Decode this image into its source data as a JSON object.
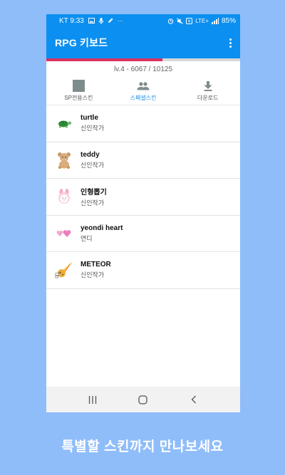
{
  "status_bar": {
    "carrier_time": "KT 9:33",
    "extra": "···",
    "network": "LTE+",
    "battery": "85%",
    "icons": [
      "image-icon",
      "mic-icon",
      "pen-icon",
      "alarm-icon",
      "mute-icon",
      "nfc-icon",
      "signal-icon"
    ]
  },
  "app_bar": {
    "title": "RPG 키보드"
  },
  "progress": {
    "level_text": "lv.4 - 6067 / 10125",
    "fraction": 0.599,
    "fill_color": "#d8325f"
  },
  "tabs": [
    {
      "label": "SP전용스킨",
      "icon": "square-icon",
      "active": false
    },
    {
      "label": "스페셜스킨",
      "icon": "people-icon",
      "active": true
    },
    {
      "label": "다운로드",
      "icon": "download-icon",
      "active": false
    }
  ],
  "skins": [
    {
      "name": "turtle",
      "author": "신인작가",
      "icon": "turtle-icon"
    },
    {
      "name": "teddy",
      "author": "신인작가",
      "icon": "teddy-bear-icon"
    },
    {
      "name": "인형뽑기",
      "author": "신인작가",
      "icon": "bunny-icon"
    },
    {
      "name": "yeondi heart",
      "author": "연디",
      "icon": "hearts-icon"
    },
    {
      "name": "METEOR",
      "author": "신인작가",
      "icon": "meteor-icon"
    }
  ],
  "nav": {
    "buttons": [
      "recent-apps-icon",
      "home-icon",
      "back-icon"
    ]
  },
  "caption": "특별할 스킨까지 만나보세요",
  "colors": {
    "background": "#8fbdfa",
    "app_bar": "#0b8ff0",
    "active_tab": "#1a8ee8"
  }
}
